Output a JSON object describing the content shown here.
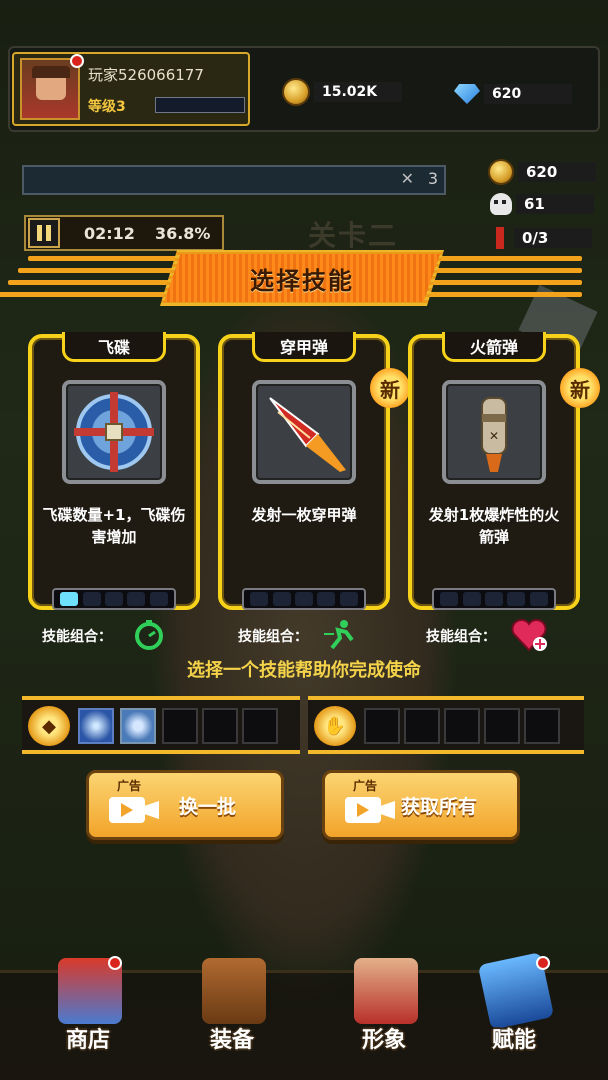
{
  "player": {
    "name": "玩家526066177",
    "level": "等级3",
    "xp_fraction": 0.0
  },
  "currencies": {
    "gold": "15.02K",
    "gems": "620"
  },
  "hud": {
    "kills_count": "3",
    "side_gold": "620",
    "side_kills": "61",
    "side_flags": "0/3",
    "timer": "02:12",
    "progress": "36.8%",
    "stage_title": "关卡二"
  },
  "skill_select": {
    "title": "选择技能",
    "cards": [
      {
        "name": "飞碟",
        "desc": "飞碟数量+1，飞碟伤害增加",
        "is_new": false,
        "level_filled": 1,
        "level_total": 5
      },
      {
        "name": "穿甲弹",
        "desc": "发射一枚穿甲弹",
        "is_new": true,
        "new_label": "新",
        "level_filled": 0,
        "level_total": 5
      },
      {
        "name": "火箭弹",
        "desc": "发射1枚爆炸性的火箭弹",
        "is_new": true,
        "new_label": "新",
        "level_filled": 0,
        "level_total": 5
      }
    ],
    "combo_label": "技能组合：",
    "hint": "选择一个技能帮助你完成使命"
  },
  "ad_buttons": {
    "ad_tag": "广告",
    "refresh": "换一批",
    "get_all": "获取所有"
  },
  "nav": {
    "shop": "商店",
    "equipment": "装备",
    "appearance": "形象",
    "talent": "赋能"
  },
  "colors": {
    "accent_yellow": "#f6d21a",
    "banner_orange": "#f07210",
    "hint_yellow": "#f4d34a"
  }
}
